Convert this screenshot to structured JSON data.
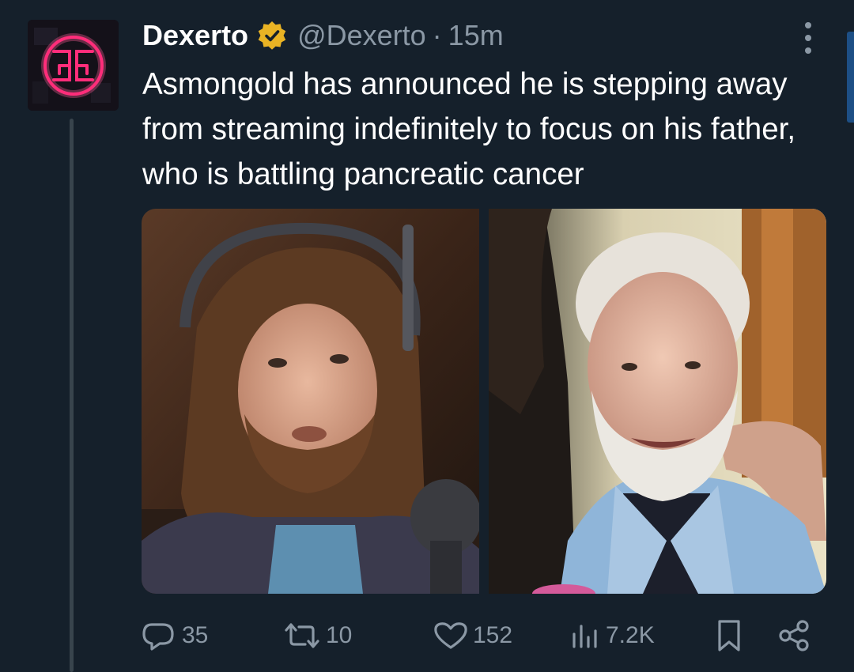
{
  "tweet": {
    "author_name": "Dexerto",
    "verified_badge_icon": "verified-gold-badge-icon",
    "handle": "@Dexerto",
    "separator": "·",
    "time": "15m",
    "text": "Asmongold has announced he is stepping away from streaming indefinitely to focus on his father, who is battling pancreatic cancer",
    "media": [
      {
        "description_icon": "photo-streamer-with-headset"
      },
      {
        "description_icon": "photo-elderly-man-smiling"
      }
    ],
    "actions": {
      "reply_count": "35",
      "retweet_count": "10",
      "like_count": "152",
      "view_count": "7.2K"
    },
    "icons": {
      "avatar": "dexerto-neon-logo-icon",
      "more": "more-vertical-icon",
      "reply": "reply-icon",
      "retweet": "retweet-icon",
      "like": "heart-icon",
      "views": "views-icon",
      "bookmark": "bookmark-icon",
      "share": "share-icon"
    }
  },
  "colors": {
    "background": "#15202b",
    "text_primary": "#ffffff",
    "text_secondary": "#8b98a5",
    "badge_gold": "#e9b324",
    "logo_neon": "#ff2d7a"
  }
}
